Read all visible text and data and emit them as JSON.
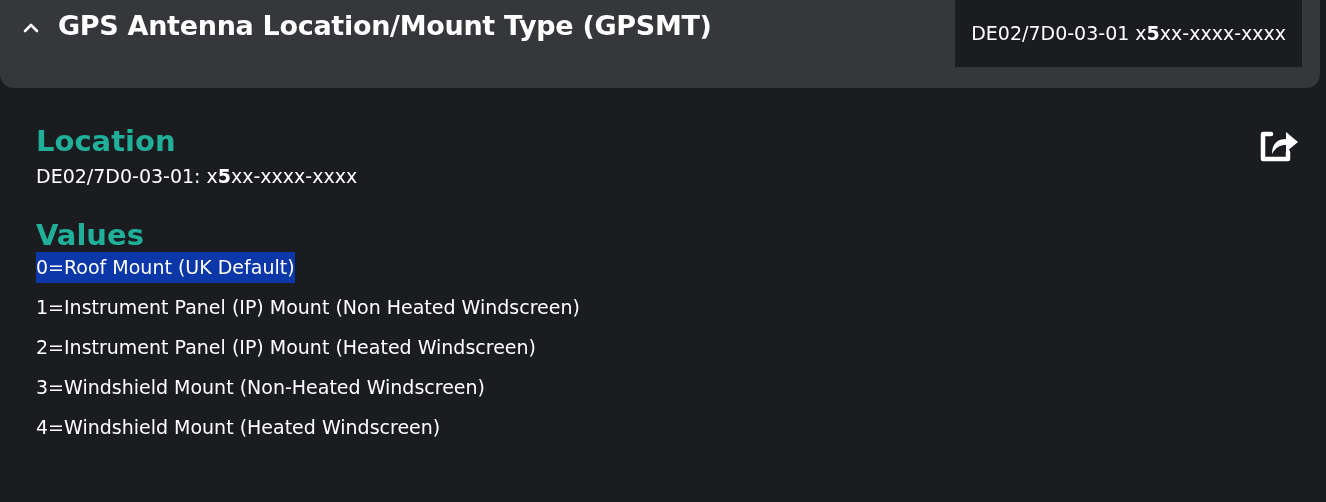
{
  "header": {
    "expanded": true,
    "title": "GPS Antenna Location/Mount Type (GPSMT)",
    "code": "DE02/7D0-03-01 x**5**xx-xxxx-xxxx"
  },
  "location": {
    "heading": "Location",
    "text": "DE02/7D0-03-01: x**5**xx-xxxx-xxxx"
  },
  "values": {
    "heading": "Values",
    "items": [
      {
        "text": "0=Roof Mount (UK Default)",
        "selected": true
      },
      {
        "text": "1=Instrument Panel (IP) Mount (Non Heated Windscreen)",
        "selected": false
      },
      {
        "text": "2=Instrument Panel (IP) Mount (Heated Windscreen)",
        "selected": false
      },
      {
        "text": "3=Windshield Mount (Non-Heated Windscreen)",
        "selected": false
      },
      {
        "text": "4=Windshield Mount (Heated Windscreen)",
        "selected": false
      }
    ]
  }
}
